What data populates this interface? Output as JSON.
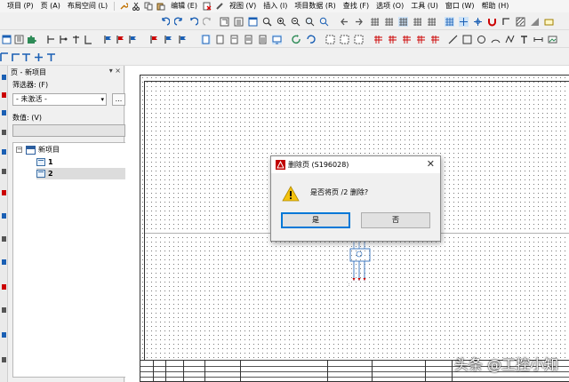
{
  "menu": {
    "items": [
      "项目 (P)",
      "页 (A)",
      "布局空间 (L)",
      "编辑 (E)",
      "视图 (V)",
      "插入 (I)",
      "项目数据 (R)",
      "查找 (F)",
      "选项 (O)",
      "工具 (U)",
      "窗口 (W)",
      "帮助 (H)"
    ]
  },
  "panel": {
    "title": "页 - 新项目",
    "controls": "▾ ×",
    "filter_label": "筛选器: (F)",
    "filter_value": "- 未激活 -",
    "more_button": "...",
    "number_label": "数值: (V)",
    "tree": {
      "project": "新项目",
      "pages": [
        "1",
        "2"
      ],
      "selected_index": 1
    }
  },
  "dialog": {
    "title": "删除页 (S196028)",
    "close": "✕",
    "message": "是否将页 /2 删除?",
    "yes_label": "是",
    "no_label": "否"
  },
  "watermark": "头条 @工控小知"
}
